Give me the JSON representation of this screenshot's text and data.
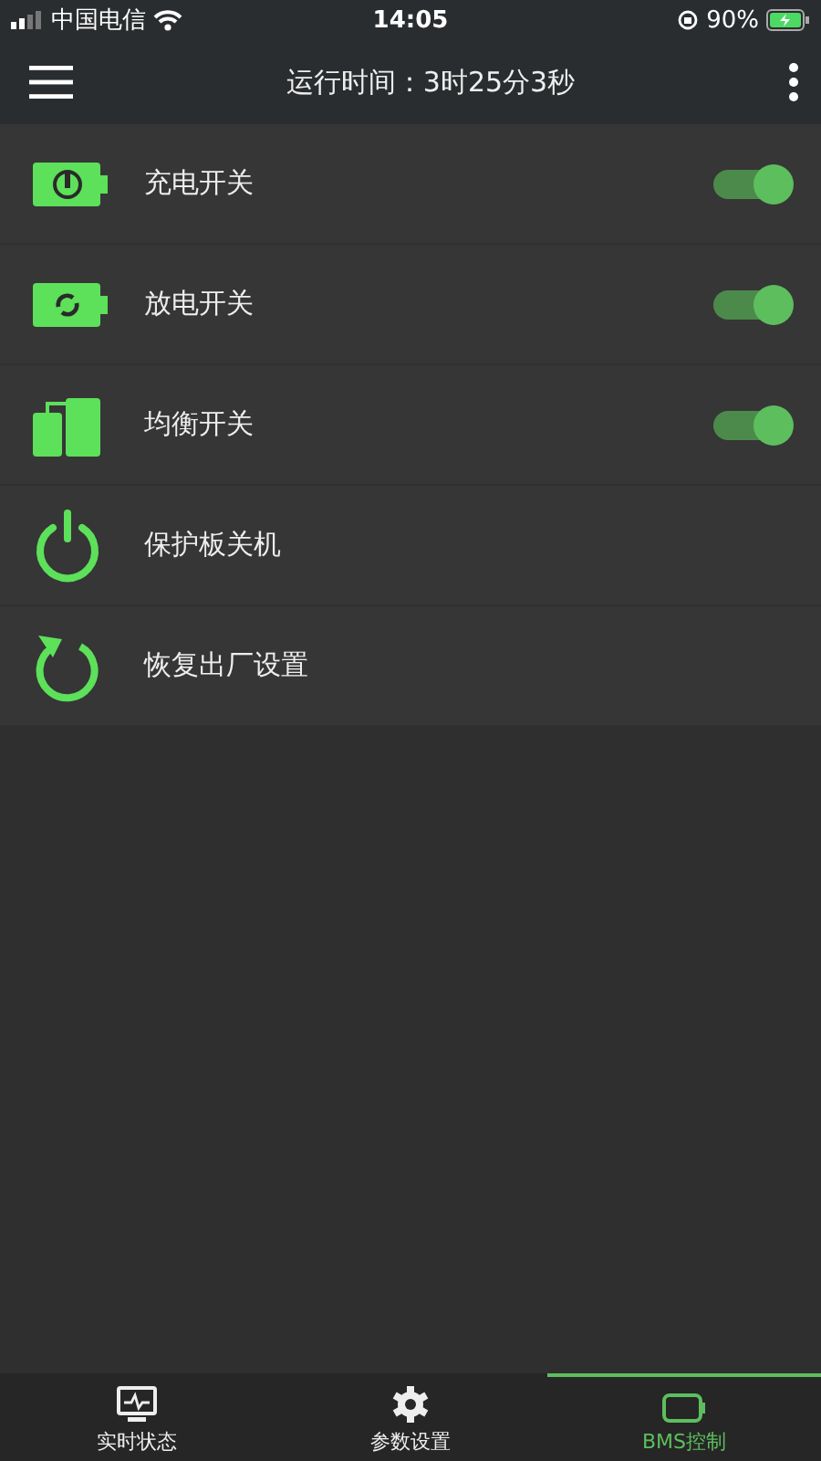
{
  "status_bar": {
    "carrier": "中国电信",
    "time": "14:05",
    "battery": "90%"
  },
  "header": {
    "title": "运行时间：3时25分3秒"
  },
  "items": [
    {
      "kind": "switch",
      "label": "充电开关",
      "on": true
    },
    {
      "kind": "switch",
      "label": "放电开关",
      "on": true
    },
    {
      "kind": "switch",
      "label": "均衡开关",
      "on": true
    },
    {
      "kind": "action",
      "label": "保护板关机"
    },
    {
      "kind": "action",
      "label": "恢复出厂设置"
    }
  ],
  "tabs": [
    {
      "label": "实时状态",
      "selected": false
    },
    {
      "label": "参数设置",
      "selected": false
    },
    {
      "label": "BMS控制",
      "selected": true
    }
  ]
}
